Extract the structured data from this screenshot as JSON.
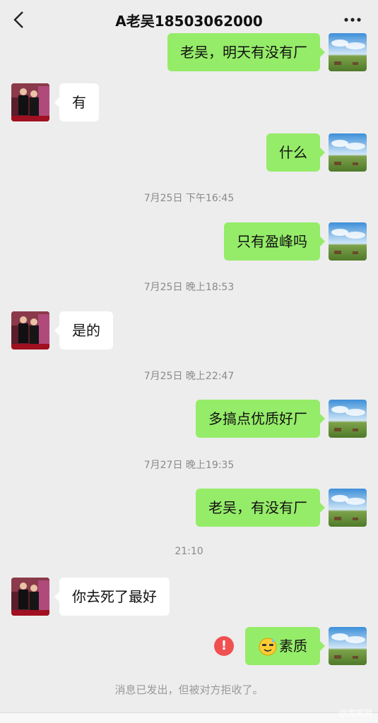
{
  "header": {
    "title": "A老吴18503062000"
  },
  "messages": [
    {
      "dir": "out",
      "text": "老吴，明天有没有厂"
    },
    {
      "dir": "in",
      "text": "有"
    },
    {
      "dir": "out",
      "text": "什么"
    },
    {
      "time": "7月25日 下午16:45"
    },
    {
      "dir": "out",
      "text": "只有盈峰吗"
    },
    {
      "time": "7月25日 晚上18:53"
    },
    {
      "dir": "in",
      "text": "是的"
    },
    {
      "time": "7月25日 晚上22:47"
    },
    {
      "dir": "out",
      "text": "多搞点优质好厂"
    },
    {
      "time": "7月27日 晚上19:35"
    },
    {
      "dir": "out",
      "text": "老吴，有没有厂"
    },
    {
      "time": "21:10"
    },
    {
      "dir": "in",
      "text": "你去死了最好"
    },
    {
      "dir": "out",
      "text": "素质",
      "emoji": "sweat-smile-emoji",
      "failed": true
    }
  ],
  "status": {
    "rejected": "消息已发出，但被对方拒收了。"
  },
  "error_icon": "!",
  "watermark": "@虎嗅网",
  "colors": {
    "background": "#ededed",
    "outgoing_bubble": "#95ec69",
    "incoming_bubble": "#ffffff",
    "error": "#f15050"
  }
}
